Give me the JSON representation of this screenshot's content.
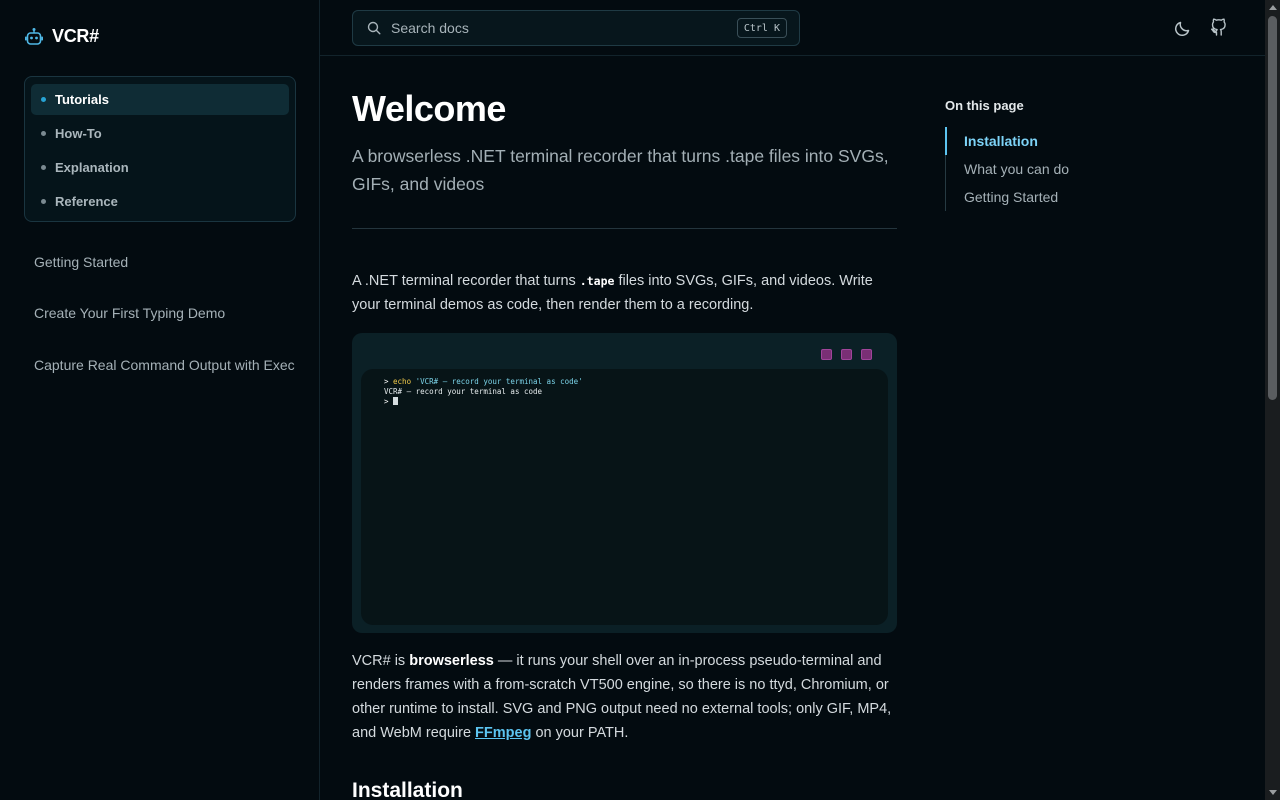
{
  "brand": {
    "name": "VCR#"
  },
  "sidebar": {
    "nav": [
      {
        "label": "Tutorials",
        "active": true
      },
      {
        "label": "How-To",
        "active": false
      },
      {
        "label": "Explanation",
        "active": false
      },
      {
        "label": "Reference",
        "active": false
      }
    ],
    "links": [
      {
        "label": "Getting Started"
      },
      {
        "label": "Create Your First Typing Demo"
      },
      {
        "label": "Capture Real Command Output with Exec"
      }
    ]
  },
  "header": {
    "search_placeholder": "Search docs",
    "search_shortcut": "Ctrl K",
    "theme_icon": "moon-icon",
    "github_icon": "github-icon"
  },
  "main": {
    "title": "Welcome",
    "subtitle": "A browserless .NET terminal recorder that turns .tape files into SVGs, GIFs, and videos",
    "intro_before": "A .NET terminal recorder that turns ",
    "intro_code": ".tape",
    "intro_after": " files into SVGs, GIFs, and videos. Write your terminal demos as code, then render them to a recording.",
    "terminal": {
      "line1_prompt": "> ",
      "line1_cmd": "echo",
      "line1_arg": " 'VCR# — record your terminal as code'",
      "line2": "VCR# — record your terminal as code",
      "line3_prompt": "> "
    },
    "body_before": "VCR# is ",
    "body_bold": "browserless",
    "body_middle": " — it runs your shell over an in-process pseudo-terminal and renders frames with a from-scratch VT500 engine, so there is no ttyd, Chromium, or other runtime to install. SVG and PNG output need no external tools; only GIF, MP4, and WebM require ",
    "body_link": "FFmpeg",
    "body_after": " on your PATH.",
    "section_heading": "Installation"
  },
  "toc": {
    "title": "On this page",
    "items": [
      {
        "label": "Installation",
        "active": true
      },
      {
        "label": "What you can do",
        "active": false
      },
      {
        "label": "Getting Started",
        "active": false
      }
    ]
  },
  "colors": {
    "background": "#030b10",
    "accent": "#5cc4f0",
    "terminal_button": "#7a2f75"
  }
}
